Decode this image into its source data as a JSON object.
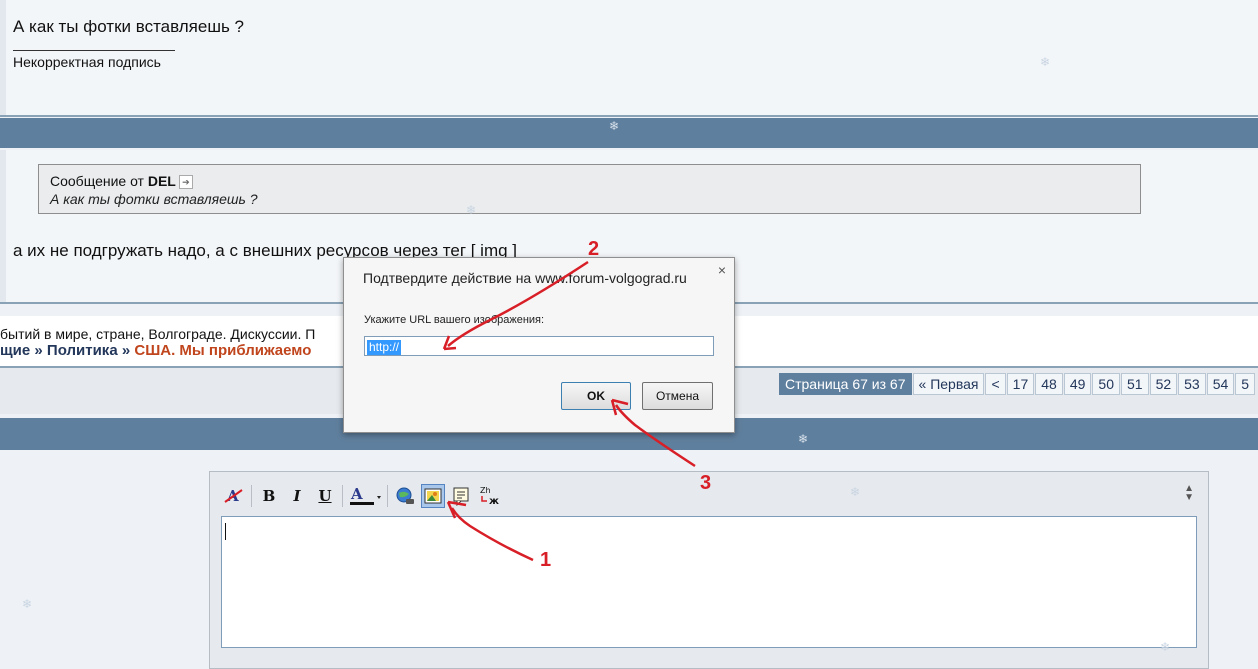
{
  "post1": {
    "text": "А как ты фотки вставляешь ?",
    "signature": "Некорректная подпись"
  },
  "post2": {
    "quote": {
      "prefix": "Сообщение от",
      "author": "DEL",
      "text": "А как ты фотки вставляешь ?"
    },
    "reply": "а их не подгружать надо, а с внешних ресурсов через тег [ img ]"
  },
  "info": {
    "description": "бытий в мире, стране, Волгограде. Дискуссии. П",
    "breadcrumb": [
      "щие",
      "»",
      "Политика",
      "»",
      "США. Мы приближаемо"
    ]
  },
  "pagination": {
    "current": "Страница 67 из 67",
    "first": "« Первая",
    "prev": "<",
    "pages": [
      "17",
      "48",
      "49",
      "50",
      "51",
      "52",
      "53",
      "54",
      "5"
    ]
  },
  "editor": {
    "toolbar": [
      {
        "icon": "remove-format-icon",
        "glyph": "A̶"
      },
      {
        "icon": "bold-icon",
        "glyph": "B"
      },
      {
        "icon": "italic-icon",
        "glyph": "I"
      },
      {
        "icon": "underline-icon",
        "glyph": "U"
      },
      {
        "icon": "font-color-icon",
        "glyph": "A"
      },
      {
        "icon": "insert-link-icon",
        "glyph": "🌐"
      },
      {
        "icon": "insert-image-icon",
        "glyph": "🖼"
      },
      {
        "icon": "quote-icon",
        "glyph": "❝"
      },
      {
        "icon": "translit-icon",
        "glyph": "Zh"
      }
    ],
    "content": ""
  },
  "dialog": {
    "title": "Подтвердите действие на www.forum-volgograd.ru",
    "close": "×",
    "prompt": "Укажите URL вашего изображения:",
    "input_value": "http://",
    "ok": "OK",
    "cancel": "Отмена"
  },
  "annotations": [
    "1",
    "2",
    "3"
  ],
  "colors": {
    "header_bar": "#5f7f9e",
    "annotation": "#d81e26",
    "link": "#23375b",
    "current_topic": "#c0451d"
  }
}
